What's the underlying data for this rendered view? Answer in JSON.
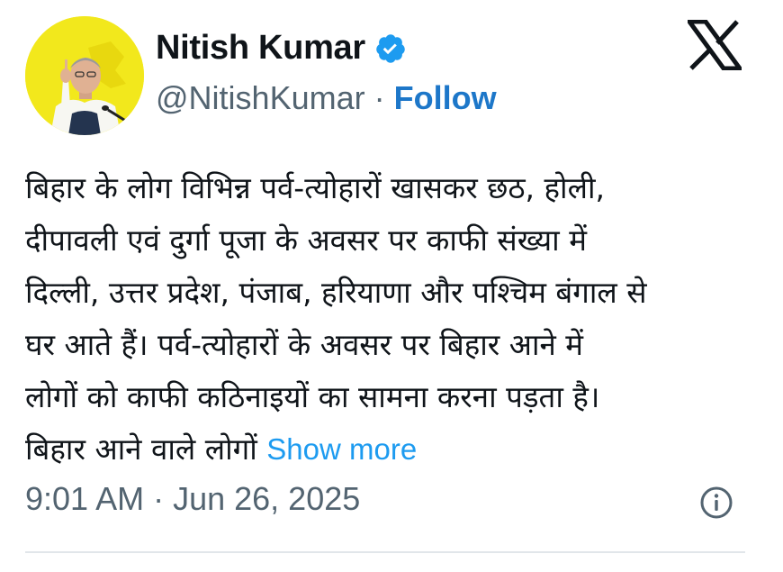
{
  "author": {
    "name": "Nitish Kumar",
    "handle": "@NitishKumar",
    "separator": "·",
    "follow_label": "Follow",
    "verified": true,
    "avatar_icon": "avatar-photo"
  },
  "platform": {
    "logo_icon": "x-logo-icon"
  },
  "tweet": {
    "text": "बिहार के लोग विभिन्न पर्व-त्योहारों खासकर छठ, होली,\nदीपावली एवं दुर्गा पूजा के अवसर पर काफी संख्या में\nदिल्ली, उत्तर प्रदेश, पंजाब, हरियाणा और पश्चिम बंगाल से\nघर आते हैं। पर्व-त्योहारों के अवसर पर बिहार आने में\nलोगों को काफी कठिनाइयों का सामना करना पड़ता है।\nबिहार आने वाले लोगों ",
    "show_more_label": "Show more",
    "timestamp": "9:01 AM · Jun 26, 2025"
  },
  "colors": {
    "follow": "#1d77c9",
    "show_more": "#1d9bf0",
    "verified_badge": "#1d9bf0",
    "avatar_background": "#f2e81c",
    "secondary_text": "#536471"
  }
}
